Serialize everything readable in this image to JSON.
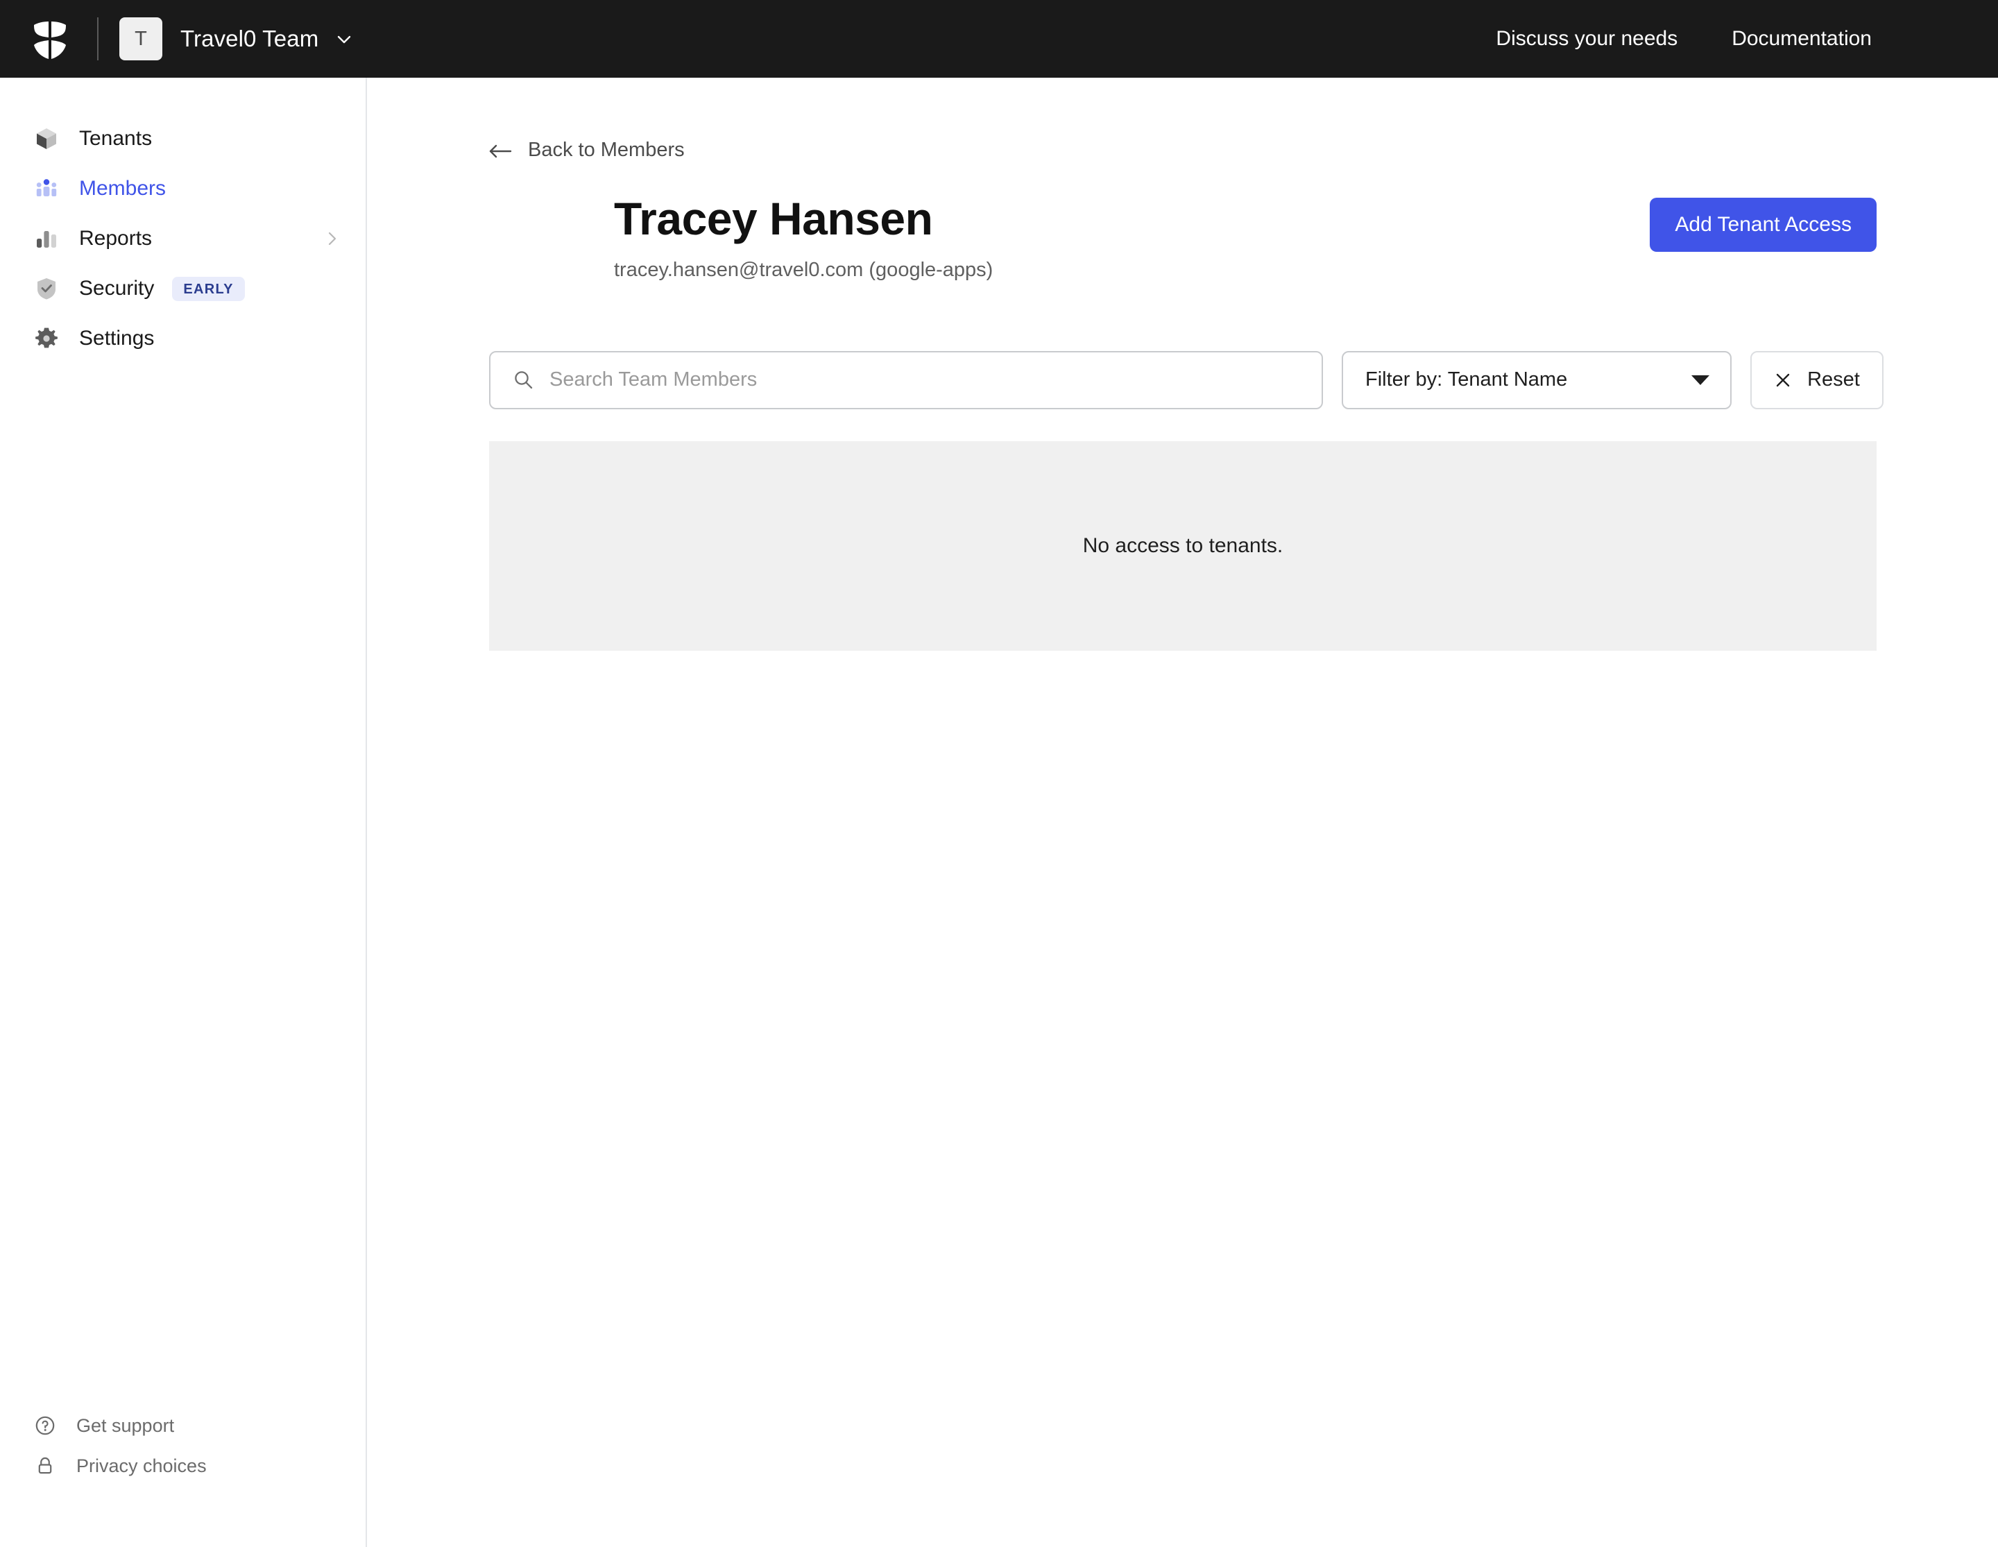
{
  "header": {
    "logo_icon": "shield-logo-icon",
    "team_initial": "T",
    "team_name": "Travel0 Team",
    "team_caret_icon": "chevron-down-icon",
    "links": [
      {
        "label": "Discuss your needs",
        "icon": ""
      },
      {
        "label": "Documentation",
        "icon": ""
      }
    ],
    "avatar_icon": "user-avatar"
  },
  "sidebar": {
    "items": [
      {
        "label": "Tenants",
        "icon": "cube-icon",
        "active": false,
        "has_chevron": false,
        "badge": ""
      },
      {
        "label": "Members",
        "icon": "people-icon",
        "active": true,
        "has_chevron": false,
        "badge": ""
      },
      {
        "label": "Reports",
        "icon": "bar-chart-icon",
        "active": false,
        "has_chevron": true,
        "badge": ""
      },
      {
        "label": "Security",
        "icon": "shield-check-icon",
        "active": false,
        "has_chevron": false,
        "badge": "EARLY"
      },
      {
        "label": "Settings",
        "icon": "gear-icon",
        "active": false,
        "has_chevron": false,
        "badge": ""
      }
    ],
    "footer": [
      {
        "label": "Get support",
        "icon": "question-circle-icon"
      },
      {
        "label": "Privacy choices",
        "icon": "lock-icon"
      }
    ]
  },
  "main": {
    "back_link": {
      "label": "Back to Members",
      "icon": "arrow-left-icon"
    },
    "profile": {
      "name": "Tracey Hansen",
      "email": "tracey.hansen@travel0.com (google-apps)",
      "avatar_icon": "member-avatar"
    },
    "primary_button": "Add Tenant Access",
    "toolbar": {
      "search_placeholder": "Search Team Members",
      "search_value": "",
      "search_icon": "search-icon",
      "filter_label": "Filter by: Tenant Name",
      "filter_caret_icon": "caret-down-icon",
      "reset_label": "Reset",
      "reset_icon": "close-x-icon"
    },
    "empty_state": "No access to tenants."
  },
  "colors": {
    "accent": "#4054e8",
    "header_bg": "#1a1a1a",
    "badge_bg": "#e9ecfb",
    "badge_fg": "#2b3d8f",
    "panel_bg": "#f0f0f0"
  }
}
